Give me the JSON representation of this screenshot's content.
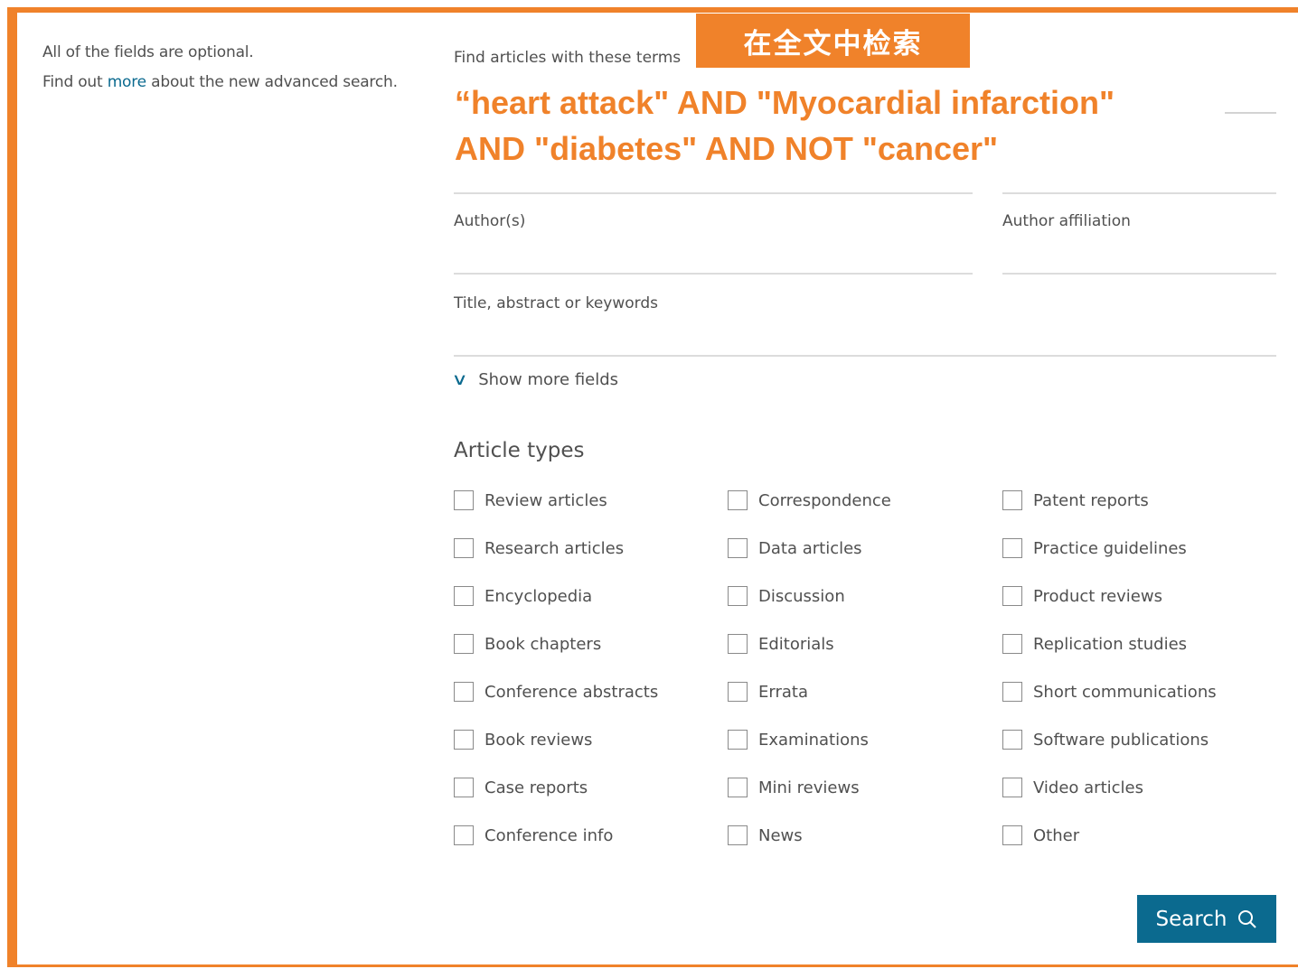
{
  "intro": {
    "line1": "All of the fields are optional.",
    "line2_prefix": "Find out ",
    "line2_link": "more",
    "line2_suffix": " about the new advanced search."
  },
  "terms": {
    "label": "Find articles with these terms",
    "banner": "在全文中检索",
    "query_line1": "“heart attack\" AND \"Myocardial infarction\"",
    "query_line2": "AND \"diabetes\" AND NOT \"cancer\""
  },
  "fields": {
    "authors": "Author(s)",
    "affiliation": "Author affiliation",
    "title_abstract": "Title, abstract or keywords"
  },
  "show_more": "Show more fields",
  "article_types": {
    "title": "Article types",
    "columns": [
      [
        "Review articles",
        "Research articles",
        "Encyclopedia",
        "Book chapters",
        "Conference abstracts",
        "Book reviews",
        "Case reports",
        "Conference info"
      ],
      [
        "Correspondence",
        "Data articles",
        "Discussion",
        "Editorials",
        "Errata",
        "Examinations",
        "Mini reviews",
        "News"
      ],
      [
        "Patent reports",
        "Practice guidelines",
        "Product reviews",
        "Replication studies",
        "Short communications",
        "Software publications",
        "Video articles",
        "Other"
      ]
    ]
  },
  "search_button": "Search",
  "colors": {
    "accent": "#f0822a",
    "link": "#0b6a8f",
    "button": "#0b6a8f"
  }
}
